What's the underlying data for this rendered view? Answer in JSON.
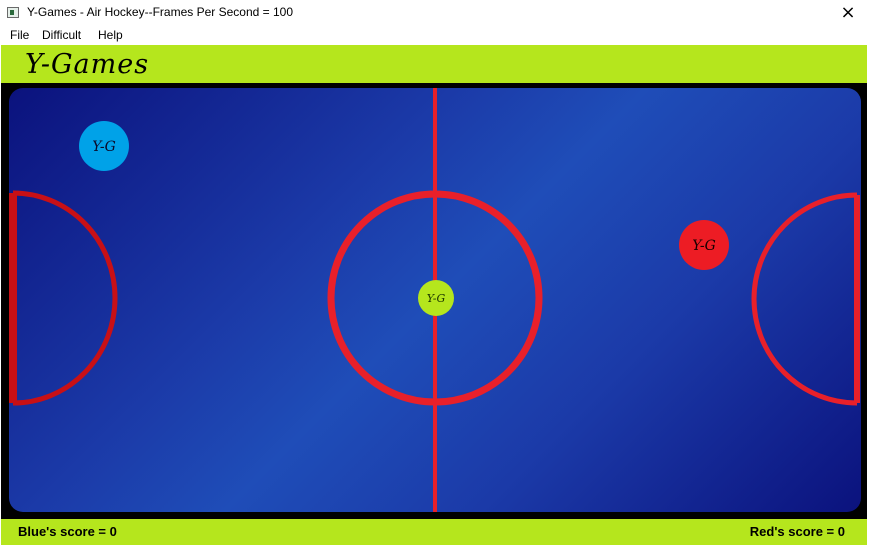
{
  "window": {
    "title": "Y-Games - Air Hockey--Frames Per Second = 100",
    "close_icon": "×"
  },
  "menu": {
    "items": [
      "File",
      "Difficult",
      "Help"
    ]
  },
  "header": {
    "brand": "Y-Games"
  },
  "game": {
    "blue_paddle_label": "Y-G",
    "red_paddle_label": "Y-G",
    "puck_label": "Y-G",
    "colors": {
      "rink_dark": "#0b127d",
      "rink_light": "#1f4db8",
      "lines": "#e8202a",
      "blue_paddle": "#00a2e8",
      "red_paddle": "#ed1c24",
      "puck": "#b5e61d",
      "accent": "#b5e61d"
    }
  },
  "footer": {
    "blue_score": "Blue's score = 0",
    "red_score": "Red's score = 0"
  }
}
